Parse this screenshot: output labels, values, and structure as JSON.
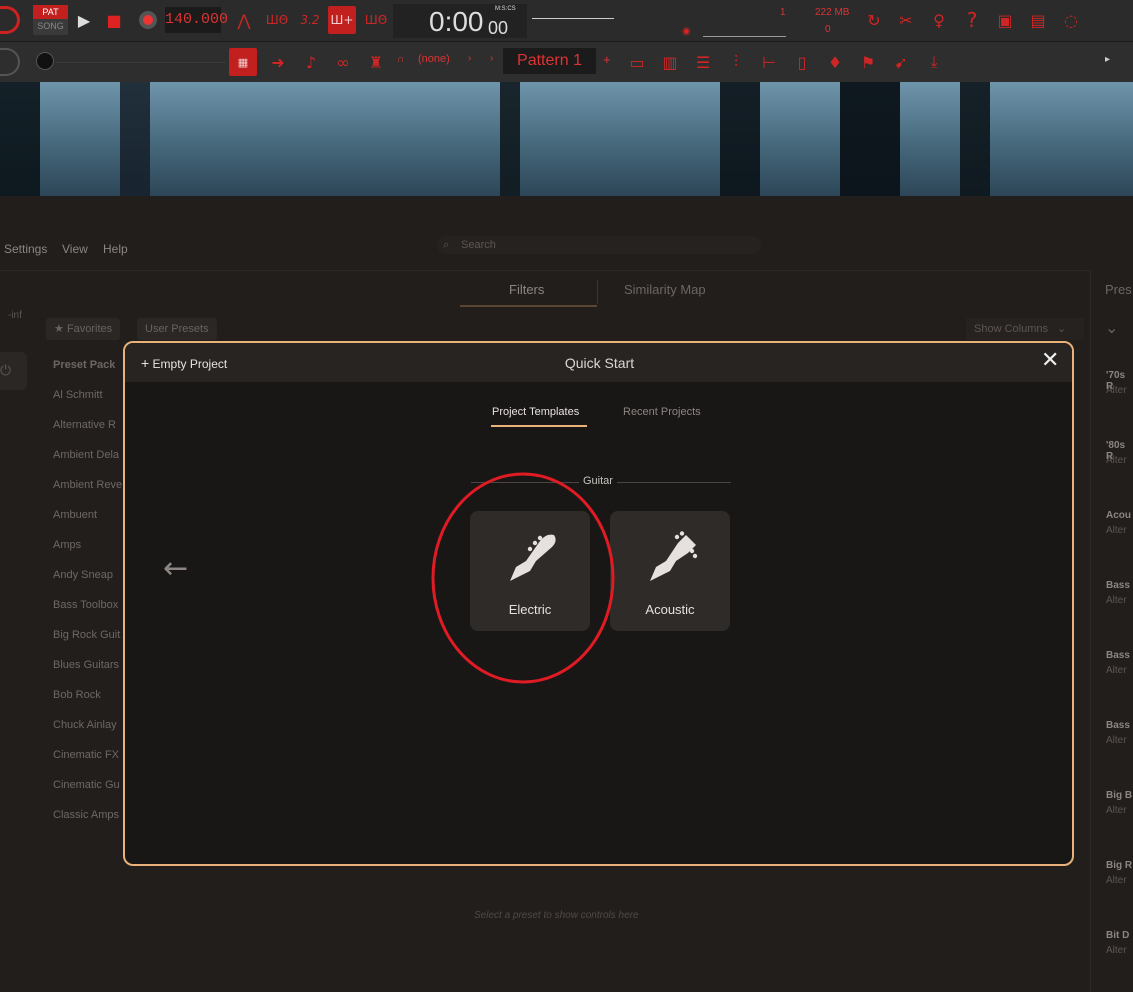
{
  "toolbar": {
    "pat_label": "PAT",
    "song_label": "SONG",
    "tempo": "140.000",
    "time_main": "0:00",
    "time_sub": "00",
    "time_format": "M:S:CS",
    "memory": "222 MB",
    "cpu_top": "1",
    "cpu_bottom": "0",
    "pattern_none": "(none)",
    "pattern_name": "Pattern 1"
  },
  "menu": {
    "settings": "Settings",
    "view": "View",
    "help": "Help"
  },
  "search": {
    "placeholder": "Search"
  },
  "browser_tabs": {
    "filters": "Filters",
    "similarity_map": "Similarity Map",
    "right_clip": "Pres"
  },
  "filters": {
    "favorites": "Favorites",
    "user_presets": "User Presets",
    "show_columns": "Show Columns",
    "level_readout": "-inf"
  },
  "sidebar": {
    "header": "Preset Pack",
    "items": [
      "Al Schmitt",
      "Alternative R",
      "Ambient Dela",
      "Ambient Reve",
      "Ambuent",
      "Amps",
      "Andy Sneap",
      "Bass Toolbox",
      "Big Rock Guit",
      "Blues Guitars",
      "Bob Rock",
      "Chuck Ainlay",
      "Cinematic FX",
      "Cinematic Gu",
      "Classic Amps"
    ]
  },
  "right_list": [
    {
      "title": "'70s R",
      "sub": "Alter"
    },
    {
      "title": "'80s R",
      "sub": "Alter"
    },
    {
      "title": "Acou",
      "sub": "Alter"
    },
    {
      "title": "Bass",
      "sub": "Alter"
    },
    {
      "title": "Bass",
      "sub": "Alter"
    },
    {
      "title": "Bass",
      "sub": "Alter"
    },
    {
      "title": "Big B",
      "sub": "Alter"
    },
    {
      "title": "Big R",
      "sub": "Alter"
    },
    {
      "title": "Bit D",
      "sub": "Alter"
    }
  ],
  "bottom_hint": "Select a preset to show controls here",
  "modal": {
    "empty_project": "Empty Project",
    "title": "Quick Start",
    "tabs": [
      "Project Templates",
      "Recent Projects"
    ],
    "section": "Guitar",
    "cards": [
      "Electric",
      "Acoustic"
    ],
    "accent_color": "#e8b27a",
    "highlight_color": "#e01b24"
  }
}
